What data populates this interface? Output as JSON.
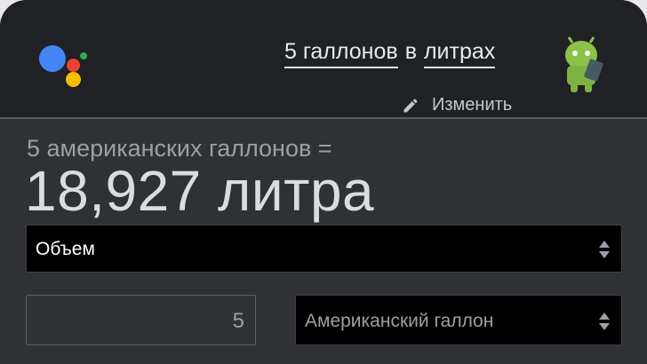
{
  "header": {
    "query_part1": "5 галлонов",
    "query_part2": "в",
    "query_part3": "литрах",
    "edit_label": "Изменить"
  },
  "icons": {
    "logo": "google-assistant-logo",
    "avatar": "android-avatar-icon",
    "edit": "pencil-icon",
    "select_arrows": "up-down-arrows-icon"
  },
  "colors": {
    "logo_blue": "#4285f4",
    "logo_red": "#ea4335",
    "logo_yellow": "#fbbc04",
    "logo_green": "#34a853",
    "background": "#303134"
  },
  "converter": {
    "equation": "5 американских галлонов =",
    "result": "18,927 литра",
    "category": "Объем",
    "input_value": "5",
    "input_unit": "Американский галлон"
  }
}
